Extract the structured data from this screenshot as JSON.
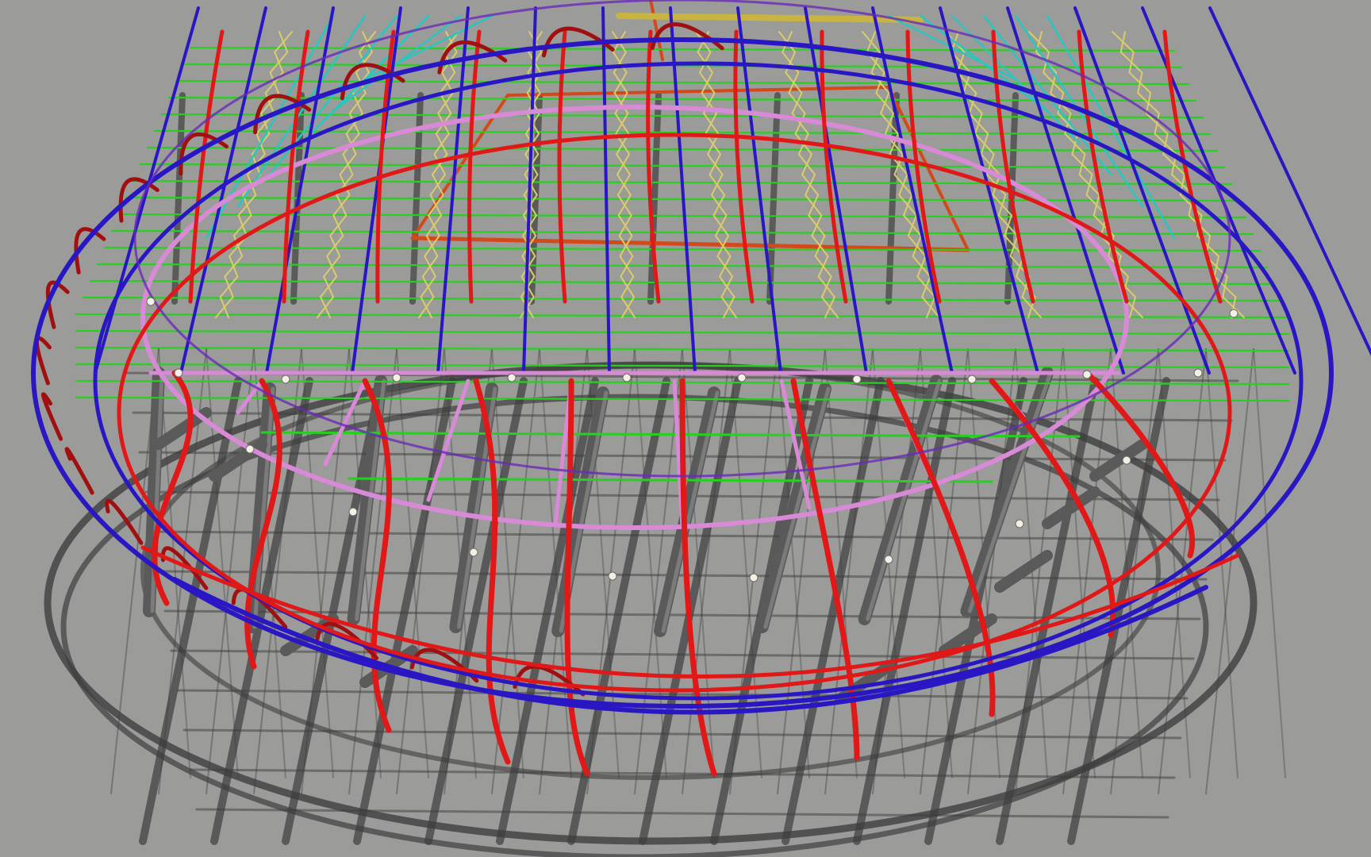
{
  "scene": {
    "subject": "steel-roof-frame-3d-render",
    "colors": {
      "background": "#9b9b99",
      "shadow": "#3e3e3e",
      "column": "#5a5a5a",
      "column_light": "#7b7b7b",
      "outer_ring": "#2a17c4",
      "red_member": "#e01818",
      "dark_red": "#a01010",
      "pink_ring": "#d98ad6",
      "purple": "#6a2bb8",
      "green": "#27d020",
      "yellow_truss": "#d8cd6a",
      "cyan": "#27c7c0",
      "orange_beam": "#d24a1a",
      "node": "#f1efe6"
    }
  }
}
